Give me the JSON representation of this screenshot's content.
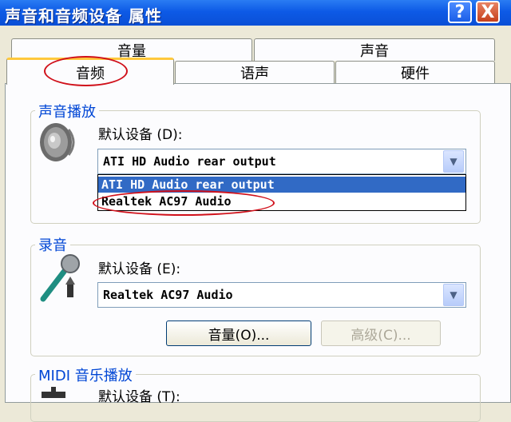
{
  "window": {
    "title": "声音和音频设备 属性",
    "help_label": "?",
    "close_label": "X"
  },
  "tabs": {
    "row1": [
      {
        "label": "音量"
      },
      {
        "label": "声音"
      }
    ],
    "row2": [
      {
        "label": "音频",
        "selected": true
      },
      {
        "label": "语声"
      },
      {
        "label": "硬件"
      }
    ]
  },
  "playback": {
    "group_title": "声音播放",
    "default_device_label": "默认设备 (D):",
    "selected_value": "ATI HD Audio rear output",
    "dropdown_options": [
      "ATI HD Audio rear output",
      "Realtek AC97 Audio"
    ],
    "highlighted_option": "ATI HD Audio rear output"
  },
  "recording": {
    "group_title": "录音",
    "default_device_label": "默认设备 (E):",
    "selected_value": "Realtek AC97 Audio",
    "volume_button": "音量(O)...",
    "advanced_button": "高级(C)..."
  },
  "midi": {
    "group_title": "MIDI 音乐播放",
    "default_device_label": "默认设备 (T):"
  },
  "icons": [
    "speaker-icon",
    "microphone-icon",
    "midi-icon",
    "chevron-down-icon",
    "help-icon",
    "close-icon"
  ],
  "colors": {
    "titlebar": "#0a4fd6",
    "group_title": "#0046d5",
    "annotation": "#d0101a",
    "selection": "#316ac5"
  }
}
